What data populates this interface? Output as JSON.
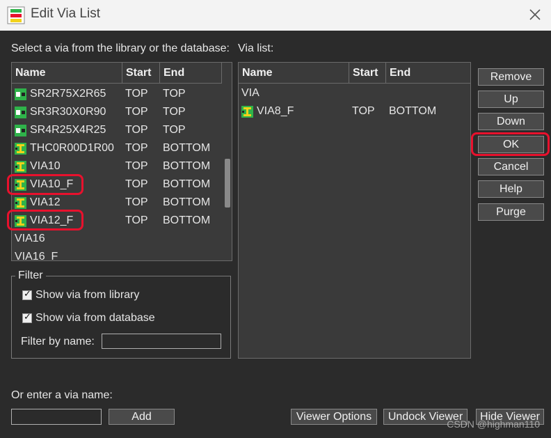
{
  "window": {
    "title": "Edit Via List"
  },
  "library": {
    "prompt": "Select a via from the library or the database:",
    "headers": {
      "name": "Name",
      "start": "Start",
      "end": "End"
    },
    "rows": [
      {
        "name": "SR2R75X2R65",
        "start": "TOP",
        "end": "TOP",
        "icon": "smd-pad-icon"
      },
      {
        "name": "SR3R30X0R90",
        "start": "TOP",
        "end": "TOP",
        "icon": "smd-pad-icon"
      },
      {
        "name": "SR4R25X4R25",
        "start": "TOP",
        "end": "TOP",
        "icon": "smd-pad-icon"
      },
      {
        "name": "THC0R00D1R00",
        "start": "TOP",
        "end": "BOTTOM",
        "icon": "via-icon"
      },
      {
        "name": "VIA10",
        "start": "TOP",
        "end": "BOTTOM",
        "icon": "via-icon"
      },
      {
        "name": "VIA10_F",
        "start": "TOP",
        "end": "BOTTOM",
        "icon": "via-icon"
      },
      {
        "name": "VIA12",
        "start": "TOP",
        "end": "BOTTOM",
        "icon": "via-icon"
      },
      {
        "name": "VIA12_F",
        "start": "TOP",
        "end": "BOTTOM",
        "icon": "via-icon"
      },
      {
        "name": "VIA16",
        "start": "",
        "end": "",
        "icon": ""
      },
      {
        "name": "VIA16_F",
        "start": "",
        "end": "",
        "icon": ""
      }
    ]
  },
  "via_list": {
    "label": "Via list:",
    "headers": {
      "name": "Name",
      "start": "Start",
      "end": "End"
    },
    "group": "VIA",
    "rows": [
      {
        "name": "VIA8_F",
        "start": "TOP",
        "end": "BOTTOM",
        "icon": "via-icon"
      }
    ]
  },
  "buttons": {
    "remove": "Remove",
    "up": "Up",
    "down": "Down",
    "ok": "OK",
    "cancel": "Cancel",
    "help": "Help",
    "purge": "Purge",
    "add": "Add",
    "viewer_options": "Viewer Options",
    "undock_viewer": "Undock Viewer",
    "hide_viewer": "Hide Viewer"
  },
  "filter": {
    "legend": "Filter",
    "show_library": "Show via from library",
    "show_database": "Show via from database",
    "show_library_checked": true,
    "show_database_checked": true,
    "by_name_label": "Filter by name:",
    "by_name_value": ""
  },
  "enter_via": {
    "label": "Or enter a via name:",
    "value": ""
  },
  "watermark": "CSDN @highman110",
  "colors": {
    "highlight": "#e8112d",
    "background": "#2b2b2b",
    "via_icon_green": "#2fb34a",
    "via_icon_yellow": "#f2d21b"
  }
}
